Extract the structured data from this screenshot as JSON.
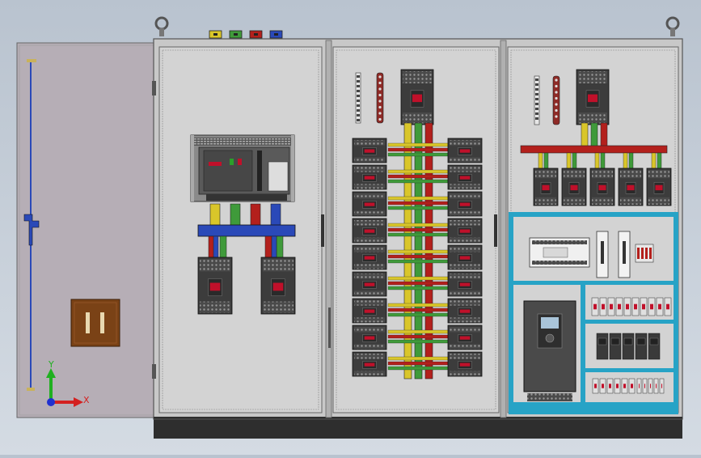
{
  "colors": {
    "background_top": "#b9c3cf",
    "background_bottom": "#d4dbe3",
    "cabinet_frame": "#c8c8c8",
    "door": "#b6aeb6",
    "panel": "#d3d3d3",
    "base": "#2e2e2e",
    "breaker_body": "#3c3c3c",
    "breaker_handle": "#c0102a",
    "bus_blue": "#2a49b8",
    "bus_red": "#b3201c",
    "bus_yellow": "#d9c62a",
    "bus_green": "#3f9a3a",
    "copper_bar": "#8e2a26",
    "cyan_frame": "#27a3c6",
    "vfd_body": "#4a4a4a",
    "handle_box": "#7a4216",
    "axis_x": "#d42020",
    "axis_y": "#20b020",
    "axis_z": "#2030d0"
  },
  "phase_tags": [
    "yellow-phase-tag",
    "green-phase-tag",
    "red-phase-tag",
    "blue-phase-tag"
  ],
  "axis": {
    "x_label": "X",
    "y_label": "Y"
  },
  "breaker_rows": 9
}
